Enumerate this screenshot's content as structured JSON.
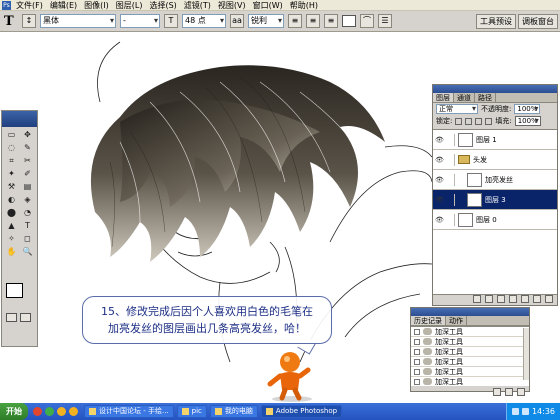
{
  "menu": [
    "文件(F)",
    "编辑(E)",
    "图像(I)",
    "图层(L)",
    "选择(S)",
    "滤镜(T)",
    "视图(V)",
    "窗口(W)",
    "帮助(H)"
  ],
  "options": {
    "tool_glyph": "T",
    "font_family": "黑体",
    "font_style": "-",
    "size_icon_label": "T",
    "font_size": "48 点",
    "aa_icon_label": "aa",
    "antialias": "锐利",
    "wells": [
      "工具预设",
      "调板窗台"
    ]
  },
  "tools": [
    "▭",
    "✥",
    "◌",
    "✎",
    "⌗",
    "✂",
    "✦",
    "✐",
    "⚒",
    "▤",
    "◐",
    "◈",
    "⬤",
    "◔",
    "▲",
    "T",
    "✧",
    "◻",
    "✋",
    "🔍"
  ],
  "layers_panel": {
    "tabs": [
      "图层",
      "通道",
      "路径"
    ],
    "blend_mode": "正常",
    "opacity_label": "不透明度:",
    "opacity": "100%",
    "lock_label": "锁定:",
    "fill_label": "填充:",
    "fill": "100%",
    "layers": [
      {
        "name": "图层 1",
        "type": "layer",
        "selected": false,
        "indent": false
      },
      {
        "name": "头发",
        "type": "group",
        "selected": false,
        "indent": false
      },
      {
        "name": "加亮发丝",
        "type": "layer",
        "selected": false,
        "indent": true
      },
      {
        "name": "图层 3",
        "type": "layer",
        "selected": true,
        "indent": true
      },
      {
        "name": "图层 0",
        "type": "layer",
        "selected": false,
        "indent": false
      }
    ]
  },
  "history_panel": {
    "tabs": [
      "历史记录",
      "动作"
    ],
    "items": [
      "加深工具",
      "加深工具",
      "加深工具",
      "加深工具",
      "加深工具",
      "加深工具"
    ]
  },
  "tip": {
    "line1": "15、修改完成后因个人喜欢用白色的毛笔在",
    "line2": "加亮发丝的图层画出几条高亮发丝，哈！"
  },
  "taskbar": {
    "start": "开始",
    "tasks": [
      {
        "label": "设计中国论坛 - 手绘...",
        "active": false
      },
      {
        "label": "pic",
        "active": false
      },
      {
        "label": "我的电脑",
        "active": false
      },
      {
        "label": "Adobe Photoshop",
        "active": true
      }
    ],
    "clock": "14:36"
  }
}
